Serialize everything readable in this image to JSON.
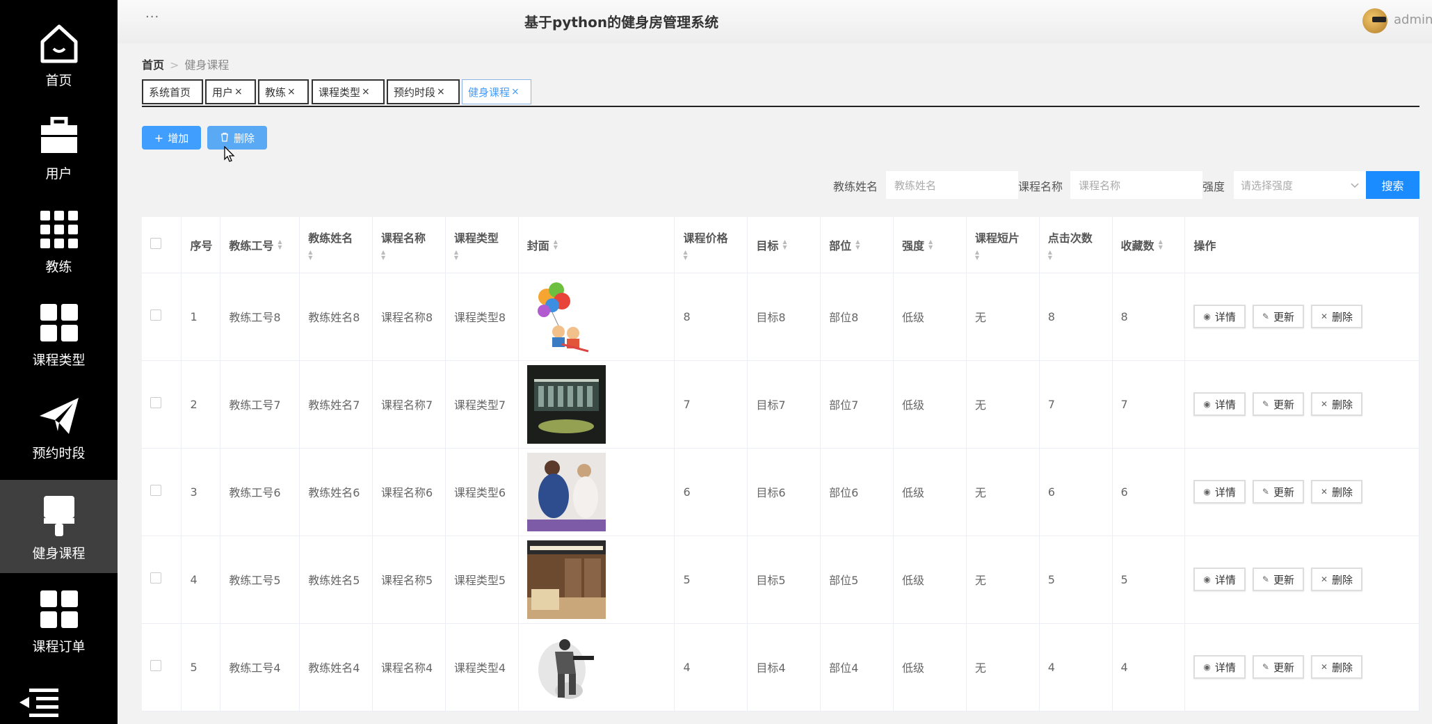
{
  "sidebar": {
    "items": [
      {
        "label": "首页",
        "icon": "home-icon"
      },
      {
        "label": "用户",
        "icon": "briefcase-icon"
      },
      {
        "label": "教练",
        "icon": "grid-9-icon"
      },
      {
        "label": "课程类型",
        "icon": "grid-4-icon"
      },
      {
        "label": "预约时段",
        "icon": "paper-plane-icon"
      },
      {
        "label": "健身课程",
        "icon": "brush-icon"
      },
      {
        "label": "课程订单",
        "icon": "grid-4-icon"
      },
      {
        "label": "",
        "icon": "menu-collapse-icon"
      }
    ]
  },
  "header": {
    "menu_dots": "···",
    "title": "基于python的健身房管理系统",
    "user": "admin"
  },
  "breadcrumb": {
    "home": "首页",
    "sep": ">",
    "current": "健身课程"
  },
  "tabs": [
    "系统首页",
    "用户",
    "教练",
    "课程类型",
    "预约时段",
    "健身课程"
  ],
  "tab_close": "×",
  "toolbar": {
    "add_label": "增加",
    "delete_label": "删除"
  },
  "search": {
    "coach_label": "教练姓名",
    "coach_placeholder": "教练姓名",
    "course_label": "课程名称",
    "course_placeholder": "课程名称",
    "intensity_label": "强度",
    "intensity_placeholder": "请选择强度",
    "button": "搜索"
  },
  "table": {
    "headers": [
      "序号",
      "教练工号",
      "教练姓名",
      "课程名称",
      "课程类型",
      "封面",
      "课程价格",
      "目标",
      "部位",
      "强度",
      "课程短片",
      "点击次数",
      "收藏数",
      "操作"
    ],
    "rows": [
      {
        "no": "1",
        "coach_id": "教练工号8",
        "coach_name": "教练姓名8",
        "course": "课程名称8",
        "type": "课程类型8",
        "price": "8",
        "goal": "目标8",
        "part": "部位8",
        "intensity": "低级",
        "video": "无",
        "clicks": "8",
        "favs": "8"
      },
      {
        "no": "2",
        "coach_id": "教练工号7",
        "coach_name": "教练姓名7",
        "course": "课程名称7",
        "type": "课程类型7",
        "price": "7",
        "goal": "目标7",
        "part": "部位7",
        "intensity": "低级",
        "video": "无",
        "clicks": "7",
        "favs": "7"
      },
      {
        "no": "3",
        "coach_id": "教练工号6",
        "coach_name": "教练姓名6",
        "course": "课程名称6",
        "type": "课程类型6",
        "price": "6",
        "goal": "目标6",
        "part": "部位6",
        "intensity": "低级",
        "video": "无",
        "clicks": "6",
        "favs": "6"
      },
      {
        "no": "4",
        "coach_id": "教练工号5",
        "coach_name": "教练姓名5",
        "course": "课程名称5",
        "type": "课程类型5",
        "price": "5",
        "goal": "目标5",
        "part": "部位5",
        "intensity": "低级",
        "video": "无",
        "clicks": "5",
        "favs": "5"
      },
      {
        "no": "5",
        "coach_id": "教练工号4",
        "coach_name": "教练姓名4",
        "course": "课程名称4",
        "type": "课程类型4",
        "price": "4",
        "goal": "目标4",
        "part": "部位4",
        "intensity": "低级",
        "video": "无",
        "clicks": "4",
        "favs": "4"
      }
    ],
    "actions": {
      "detail": "详情",
      "update": "更新",
      "delete": "删除"
    }
  },
  "colors": {
    "primary": "#409eff",
    "sidebar_bg": "#000000",
    "sidebar_active": "#3f3f3f"
  }
}
